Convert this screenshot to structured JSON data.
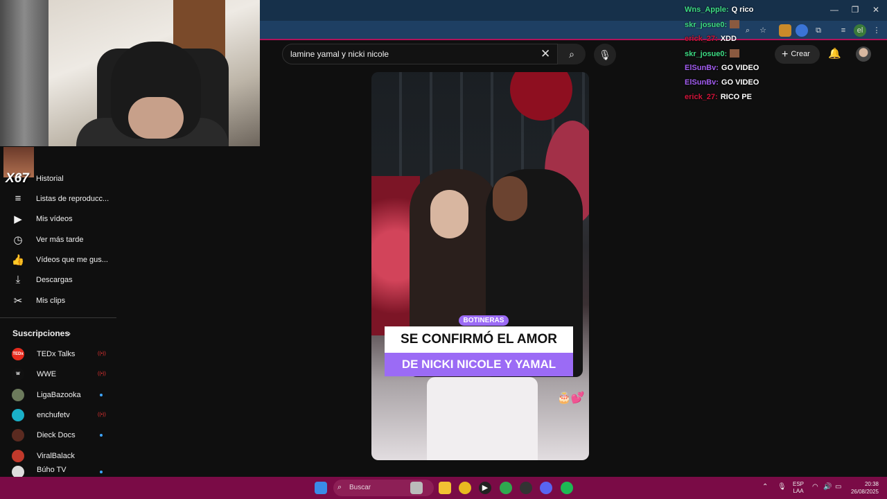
{
  "browser": {
    "minimize": "—",
    "restore": "❐",
    "close": "✕",
    "profile_initials": "el"
  },
  "webcam": {
    "emote_label": "X67"
  },
  "sidebar": {
    "items": [
      {
        "icon": "history-icon",
        "glyph": "↺",
        "label": "Historial"
      },
      {
        "icon": "playlist-icon",
        "glyph": "≡",
        "label": "Listas de reproducc..."
      },
      {
        "icon": "my-videos-icon",
        "glyph": "▶",
        "label": "Mis vídeos"
      },
      {
        "icon": "watch-later-icon",
        "glyph": "◷",
        "label": "Ver más tarde"
      },
      {
        "icon": "liked-icon",
        "glyph": "👍",
        "label": "Vídeos que me gus..."
      },
      {
        "icon": "download-icon",
        "glyph": "⤓",
        "label": "Descargas"
      },
      {
        "icon": "clips-icon",
        "glyph": "✂",
        "label": "Mis clips"
      }
    ],
    "subscriptions_title": "Suscripciones",
    "subscriptions_chevron": "›",
    "subscriptions": [
      {
        "name": "TEDx Talks",
        "avatar_text": "TEDx",
        "color": "#e62b1e",
        "status": "live",
        "status_text": "((•))"
      },
      {
        "name": "WWE",
        "avatar_text": "W",
        "color": "#111111",
        "status": "live",
        "status_text": "((•))"
      },
      {
        "name": "LigaBazooka",
        "avatar_text": "",
        "color": "#6c7a5c",
        "status": "new",
        "status_text": ""
      },
      {
        "name": "enchufetv",
        "avatar_text": "",
        "color": "#1ab0c8",
        "status": "live",
        "status_text": "((•))"
      },
      {
        "name": "Dieck Docs",
        "avatar_text": "",
        "color": "#5a2a20",
        "status": "new",
        "status_text": ""
      },
      {
        "name": "ViralBalack",
        "avatar_text": "",
        "color": "#c0392b",
        "status": "none",
        "status_text": ""
      },
      {
        "name": "Búho TV",
        "avatar_text": "",
        "color": "#dddddd",
        "status": "new",
        "status_text": ""
      }
    ]
  },
  "search": {
    "query": "lamine yamal y nicki nicole",
    "clear_glyph": "✕",
    "search_glyph": "⌕",
    "mic_glyph": "🎙"
  },
  "header": {
    "create_label": "Crear",
    "create_glyph": "+",
    "bell_glyph": "🔔"
  },
  "video": {
    "tag": "BOTINERAS",
    "line1": "SE CONFIRMÓ EL AMOR",
    "line2": "DE NICKI NICOLE Y YAMAL",
    "emoji": "🎂💕"
  },
  "chat": [
    {
      "user": "Wns_Apple:",
      "color": "#3ddc84",
      "msg": "Q rico",
      "emote": false
    },
    {
      "user": "skr_josue0:",
      "color": "#3ddc84",
      "msg": "",
      "emote": true
    },
    {
      "user": "erick_27:",
      "color": "#d2143a",
      "msg": "XDD",
      "emote": false
    },
    {
      "user": "skr_josue0:",
      "color": "#3ddc84",
      "msg": "",
      "emote": true
    },
    {
      "user": "ElSunBv:",
      "color": "#a35df2",
      "msg": "GO VIDEO",
      "emote": false
    },
    {
      "user": "ElSunBv:",
      "color": "#a35df2",
      "msg": "GO VIDEO",
      "emote": false
    },
    {
      "user": "erick_27:",
      "color": "#d2143a",
      "msg": "RICO PE",
      "emote": false
    }
  ],
  "taskbar": {
    "search_label": "Buscar",
    "lang_top": "ESP",
    "lang_bottom": "LAA",
    "time": "20:38",
    "date": "26/08/2025"
  }
}
